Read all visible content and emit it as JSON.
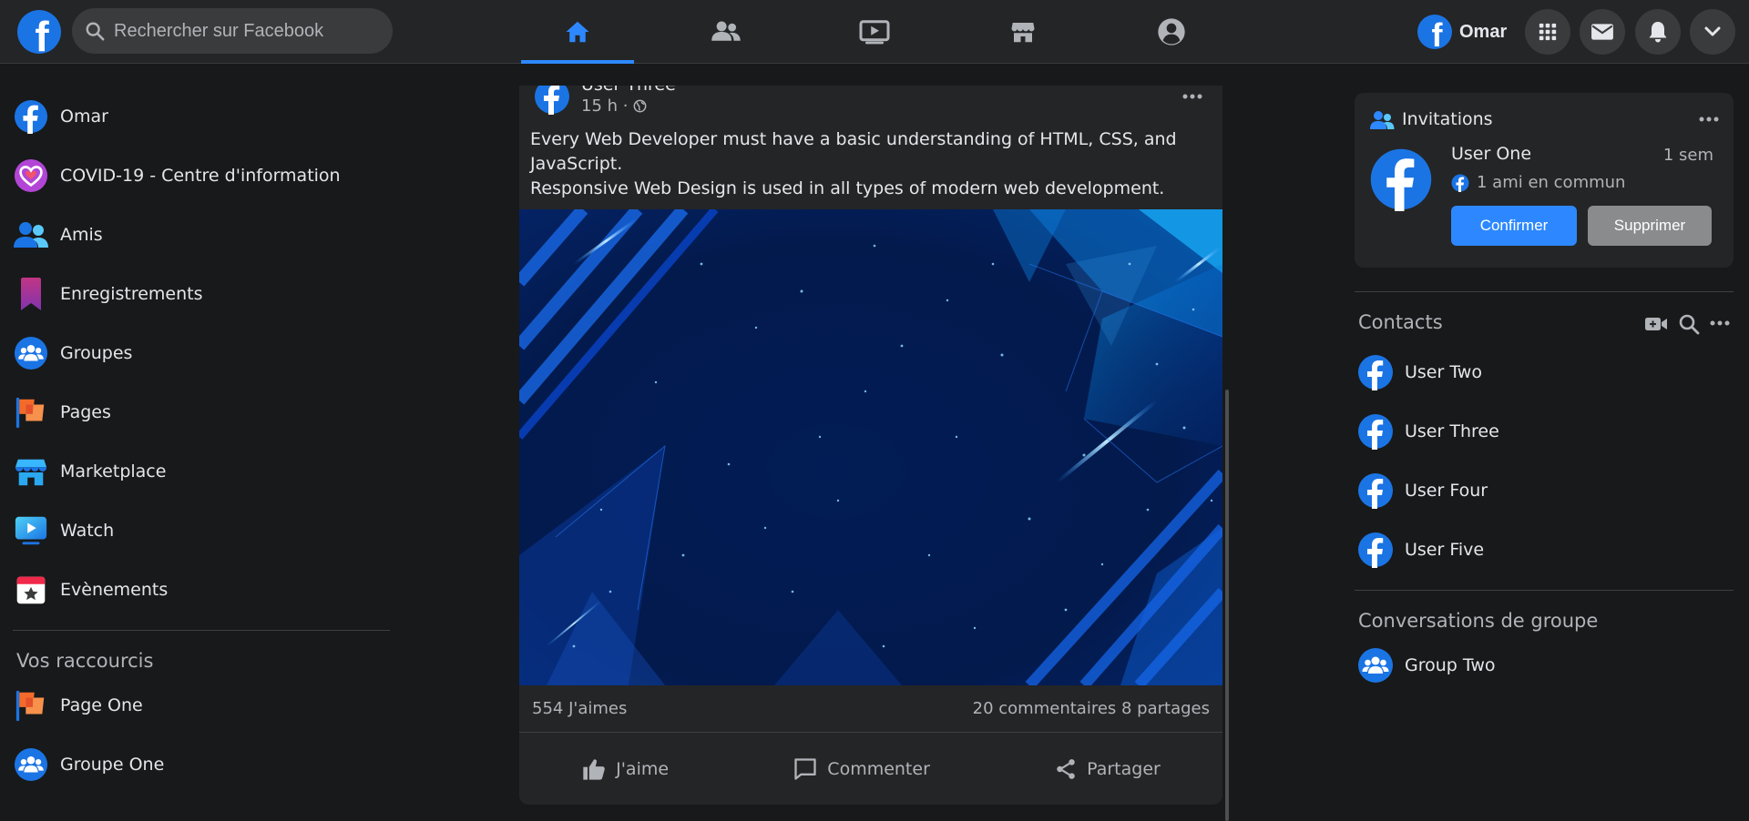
{
  "header": {
    "search_placeholder": "Rechercher sur Facebook",
    "profile_name": "Omar",
    "nav_tabs": [
      "home",
      "friends",
      "watch",
      "marketplace",
      "groups"
    ]
  },
  "sidebar": {
    "items": [
      {
        "label": "Omar",
        "icon": "facebook-logo-icon"
      },
      {
        "label": "COVID-19 - Centre d'information",
        "icon": "heart-care-icon"
      },
      {
        "label": "Amis",
        "icon": "friends-icon"
      },
      {
        "label": "Enregistrements",
        "icon": "bookmark-icon"
      },
      {
        "label": "Groupes",
        "icon": "groups-icon"
      },
      {
        "label": "Pages",
        "icon": "flag-icon"
      },
      {
        "label": "Marketplace",
        "icon": "store-icon"
      },
      {
        "label": "Watch",
        "icon": "play-screen-icon"
      },
      {
        "label": "Evènements",
        "icon": "calendar-star-icon"
      }
    ],
    "shortcuts_title": "Vos raccourcis",
    "shortcuts": [
      {
        "label": "Page One",
        "icon": "flag-icon"
      },
      {
        "label": "Groupe One",
        "icon": "groups-icon"
      }
    ]
  },
  "post": {
    "author": "User Three",
    "time": "15 h ·",
    "text_line1": "Every Web Developer must have a basic understanding of HTML, CSS, and JavaScript.",
    "text_line2": "Responsive Web Design is used in all types of modern web development.",
    "likes": "554 J'aimes",
    "comments_shares": "20 commentaires 8 partages",
    "actions": {
      "like": "J'aime",
      "comment": "Commenter",
      "share": "Partager"
    }
  },
  "invitations": {
    "title": "Invitations",
    "user": "User One",
    "time": "1 sem",
    "mutual": "1 ami en commun",
    "confirm": "Confirmer",
    "delete": "Supprimer"
  },
  "contacts": {
    "title": "Contacts",
    "items": [
      "User Two",
      "User Three",
      "User Four",
      "User Five"
    ]
  },
  "group_conversations": {
    "title": "Conversations de groupe",
    "items": [
      "Group Two"
    ]
  },
  "colors": {
    "background": "#18191a",
    "surface": "#242526",
    "accent": "#2d88ff",
    "facebook_blue": "#1b74e4"
  }
}
